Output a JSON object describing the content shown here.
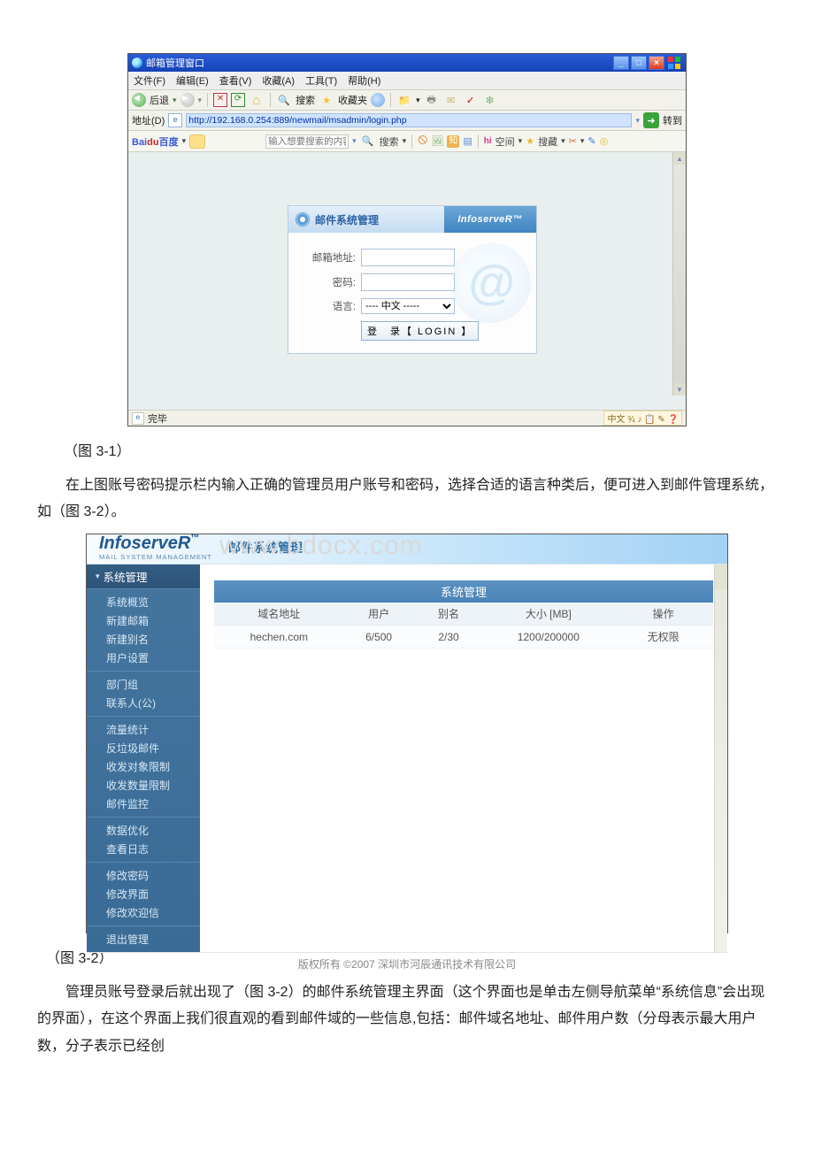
{
  "fig1": {
    "titlebar": "邮箱管理窗口",
    "menu": {
      "file": "文件(F)",
      "edit": "编辑(E)",
      "view": "查看(V)",
      "fav": "收藏(A)",
      "tool": "工具(T)",
      "help": "帮助(H)"
    },
    "toolbar": {
      "back": "后退"
    },
    "addr": {
      "label": "地址(D)",
      "url": "http://192.168.0.254:889/newmail/msadmin/login.php",
      "go": "转到"
    },
    "linkbar": {
      "baidu_bai": "Bai",
      "baidu_du": "du",
      "baidu_cn": "百度",
      "search_ph": "输入想要搜索的内容",
      "search_btn": "搜索",
      "space": "空间",
      "soucang": "搜藏"
    },
    "login": {
      "heading": "邮件系统管理",
      "brand": "InfoserveR™",
      "email_label": "邮箱地址:",
      "pass_label": "密码:",
      "lang_label": "语言:",
      "lang_opt": "---- 中文 -----",
      "login_btn": "登　录【 LOGIN 】"
    },
    "status": {
      "done": "完毕",
      "tray": "中文 ¾ ♪ 📋 ✎ ❓"
    }
  },
  "caption1": "（图 3-1）",
  "para1": "在上图账号密码提示栏内输入正确的管理员用户账号和密码，选择合适的语言种类后，便可进入到邮件管理系统，如（图 3-2）。",
  "watermark": "www.bdocx.com",
  "fig2": {
    "logo": "InfoserveR",
    "logo_sub": "MAIL SYSTEM MANAGEMENT",
    "title": "邮件系统管理",
    "side_head": "系统管理",
    "menu": [
      [
        "系统概览",
        "新建邮箱",
        "新建别名",
        "用户设置"
      ],
      [
        "部门组",
        "联系人(公)"
      ],
      [
        "流量统计",
        "反垃圾邮件",
        "收发对象限制",
        "收发数量限制",
        "邮件监控"
      ],
      [
        "数据优化",
        "查看日志"
      ],
      [
        "修改密码",
        "修改界面",
        "修改欢迎信"
      ],
      [
        "退出管理"
      ]
    ],
    "table": {
      "title": "系统管理",
      "headers": [
        "域名地址",
        "用户",
        "别名",
        "大小 [MB]",
        "操作"
      ],
      "row": [
        "hechen.com",
        "6/500",
        "2/30",
        "1200/200000",
        "无权限"
      ]
    },
    "footer": "版权所有 ©2007 深圳市河辰通讯技术有限公司"
  },
  "caption2": "（图 3-2）",
  "para2": "管理员账号登录后就出现了（图 3-2）的邮件系统管理主界面（这个界面也是单击左侧导航菜单“系统信息”会出现的界面），在这个界面上我们很直观的看到邮件域的一些信息,包括：邮件域名地址、邮件用户数（分母表示最大用户数，分子表示已经创"
}
